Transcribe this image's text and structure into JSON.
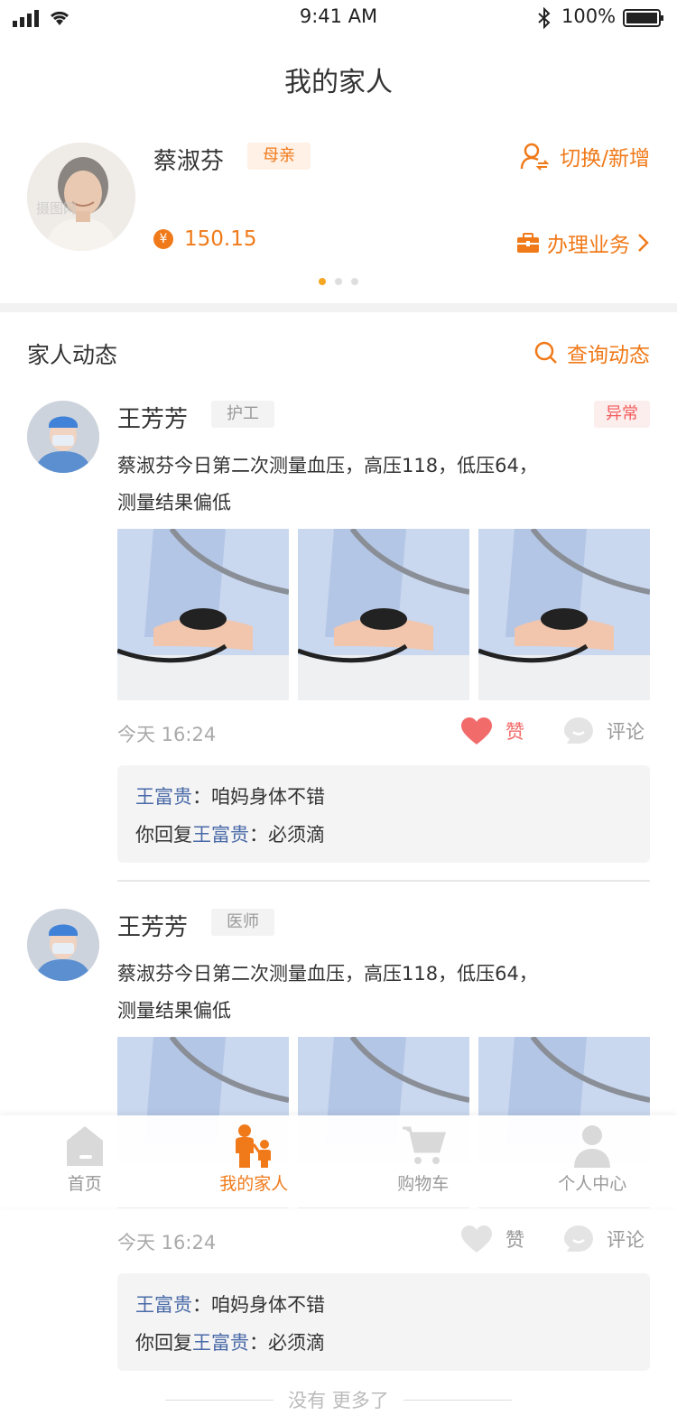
{
  "status_bar": {
    "time": "9:41 AM",
    "battery": "100%"
  },
  "nav": {
    "title": "我的家人"
  },
  "profile": {
    "name": "蔡淑芬",
    "relation": "母亲",
    "switch_label": "切换/新增",
    "balance": "150.15",
    "coin_symbol": "¥",
    "service_label": "办理业务",
    "avatar_watermark": "摄图网",
    "pages": 3,
    "active_page": 0
  },
  "section": {
    "title": "家人动态",
    "query_label": "查询动态"
  },
  "feed": [
    {
      "author": "王芳芳",
      "role": "护工",
      "status": "异常",
      "content_line1": "蔡淑芬今日第二次测量血压，高压118，低压64，",
      "content_line2": "测量结果偏低",
      "time": "今天 16:24",
      "like_label": "赞",
      "liked": true,
      "comment_label": "评论",
      "reply1_name": "王富贵",
      "reply1_text": "：咱妈身体不错",
      "reply2_prefix": "你回复",
      "reply2_name": "王富贵",
      "reply2_text": "：必须滴"
    },
    {
      "author": "王芳芳",
      "role": "医师",
      "content_line1": "蔡淑芬今日第二次测量血压，高压118，低压64，",
      "content_line2": "测量结果偏低",
      "time": "今天 16:24",
      "like_label": "赞",
      "liked": false,
      "comment_label": "评论",
      "reply1_name": "王富贵",
      "reply1_text": "：咱妈身体不错",
      "reply2_prefix": "你回复",
      "reply2_name": "王富贵",
      "reply2_text": "：必须滴"
    }
  ],
  "end_text": "没有 更多了",
  "tabbar": [
    {
      "label": "首页",
      "icon": "home-icon",
      "active": false
    },
    {
      "label": "我的家人",
      "icon": "family-icon",
      "active": true
    },
    {
      "label": "购物车",
      "icon": "cart-icon",
      "active": false
    },
    {
      "label": "个人中心",
      "icon": "user-icon",
      "active": false
    }
  ],
  "colors": {
    "accent": "#f07a1a",
    "like": "#f26b6b",
    "link": "#4a6aa8",
    "abnormal": "#f25a5a"
  }
}
